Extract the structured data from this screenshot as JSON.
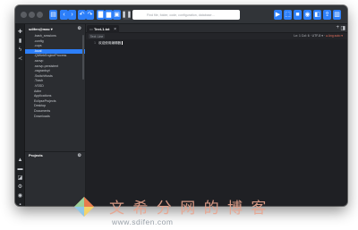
{
  "toolbar": {
    "search_placeholder": "Find file, folder, code, configuration, database…",
    "icons": [
      "sidebar-toggle-icon",
      "back-icon",
      "forward-icon",
      "undo-icon",
      "redo-icon",
      "new-file-icon",
      "open-folder-icon",
      "save-icon",
      "pause-icon",
      "run-icon",
      "share-icon",
      "layout-icon"
    ]
  },
  "sidebar": {
    "title": "sdifen@mac ▾",
    "items": [
      ".bash_sessions",
      ".config",
      ".cups",
      ".local",
      ".QtWebEngineProcess",
      ".ssnvp",
      ".ssnvp-persistent",
      ".vagrantcyt",
      ".SwitchHosts",
      ".Trash",
      ".VSSD",
      "Adlm",
      "Applications",
      "EclipseProjects",
      "Desktop",
      "Documents",
      "Downloads"
    ],
    "selected_index": 3,
    "projects_label": "Projects"
  },
  "editor": {
    "tab_label": "Text-1.txt",
    "mode_pill": "Text: Line",
    "status": "Ln: 1  Col: 6  ·  UTF-8 ▾  ·",
    "status_warn": "● Ang:auto ▾",
    "line_number": "1",
    "line_text": "欢迎使用编辑器"
  },
  "watermark": {
    "site_cn": "文 希 分 网 的 博 客",
    "site_url": "www.sdifen.com"
  },
  "colors": {
    "accent": "#2d7ff9",
    "window_bg": "#25272b",
    "editor_bg": "#1f2024"
  }
}
